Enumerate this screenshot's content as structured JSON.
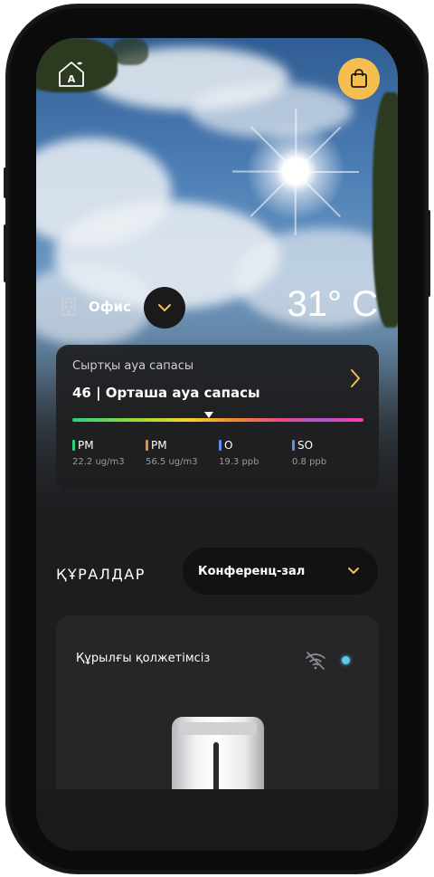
{
  "header": {
    "home_icon": "home-a-icon",
    "cart_icon": "shopping-bag-icon",
    "accent": "#f4bf4f"
  },
  "location": {
    "label": "Офис",
    "icon": "building-icon",
    "dropdown_icon": "chevron-down-icon"
  },
  "weather": {
    "temperature": "31° C"
  },
  "air_quality": {
    "title": "Сыртқы ауа сапасы",
    "value_text": "46 | Орташа ауа сапасы",
    "level_fraction": 0.47,
    "pollutants": [
      {
        "name": "PM",
        "value": "22.2 ug/m3",
        "color": "#2fd07e"
      },
      {
        "name": "PM",
        "value": "56.5 ug/m3",
        "color": "#f28a2e"
      },
      {
        "name": "O",
        "value": "19.3 ppb",
        "color": "#5a8ef0"
      },
      {
        "name": "SO",
        "value": "0.8 ppb",
        "color": "#5a8ef0"
      }
    ]
  },
  "tools": {
    "title": "ҚҰРАЛДАР",
    "room": "Конференц-зал"
  },
  "device": {
    "status": "Құрылғы қолжетімсіз",
    "status_dot_color": "#5bc8f2",
    "connectivity_icon": "wifi-off-icon"
  }
}
